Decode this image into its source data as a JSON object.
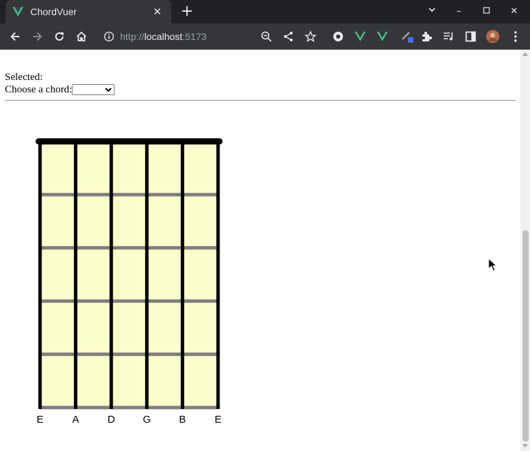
{
  "browser": {
    "tab_title": "ChordVuer",
    "tab_close": "✕",
    "new_tab": "+",
    "url_proto": "http://",
    "url_host": "localhost",
    "url_port": ":5173",
    "accent": "#42b883",
    "chrome_dark": "#202124",
    "chrome_toolbar": "#35363a",
    "window_controls": {
      "tab_search": "⌄",
      "minimize": "–",
      "maximize": "☐",
      "close": "✕"
    }
  },
  "page": {
    "selected_label": "Selected:",
    "choose_label": "Choose a chord:",
    "chord_select_value": ""
  },
  "fretboard": {
    "strings": [
      "E",
      "A",
      "D",
      "G",
      "B",
      "E"
    ],
    "frets": 5,
    "board_color": "#fbffcc",
    "fret_color": "#7f7f7f",
    "string_color": "#000000"
  }
}
